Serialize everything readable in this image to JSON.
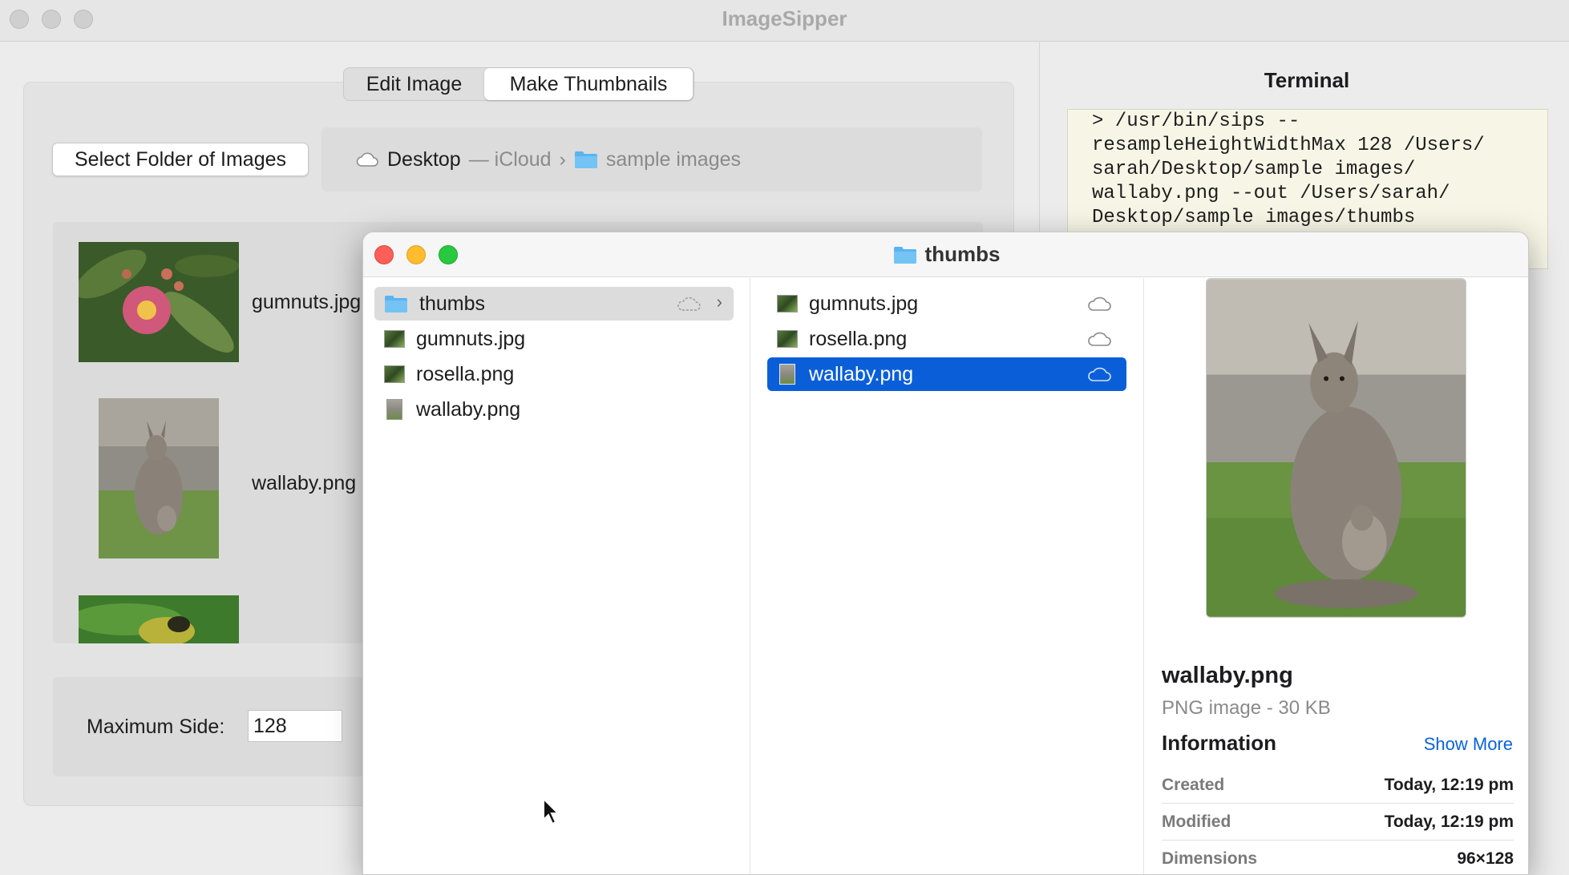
{
  "app": {
    "title": "ImageSipper"
  },
  "tabs": {
    "edit_label": "Edit Image",
    "make_label": "Make Thumbnails"
  },
  "toolbar": {
    "select_folder_label": "Select Folder of Images"
  },
  "path": {
    "desktop": "Desktop",
    "icloud": "— iCloud",
    "separator": "›",
    "folder": "sample images"
  },
  "thumbnails": [
    {
      "name": "gumnuts.jpg"
    },
    {
      "name": "wallaby.png"
    }
  ],
  "settings": {
    "max_side_label": "Maximum Side:",
    "max_side_value": "128"
  },
  "terminal": {
    "title": "Terminal",
    "text": "> /usr/bin/sips --\nresampleHeightWidthMax 128 /Users/\nsarah/Desktop/sample images/\nwallaby.png --out /Users/sarah/\nDesktop/sample images/thumbs"
  },
  "finder": {
    "title": "thumbs",
    "col1": [
      {
        "name": "thumbs",
        "type": "folder",
        "selected": true
      },
      {
        "name": "gumnuts.jpg",
        "type": "image"
      },
      {
        "name": "rosella.png",
        "type": "image"
      },
      {
        "name": "wallaby.png",
        "type": "image-portrait"
      }
    ],
    "col2": [
      {
        "name": "gumnuts.jpg",
        "type": "image"
      },
      {
        "name": "rosella.png",
        "type": "image"
      },
      {
        "name": "wallaby.png",
        "type": "image-portrait",
        "selected": true
      }
    ],
    "preview": {
      "name": "wallaby.png",
      "kind": "PNG image - 30 KB",
      "info_heading": "Information",
      "show_more": "Show More",
      "rows": [
        {
          "key": "Created",
          "value": "Today, 12:19 pm"
        },
        {
          "key": "Modified",
          "value": "Today, 12:19 pm"
        },
        {
          "key": "Dimensions",
          "value": "96×128"
        }
      ]
    }
  },
  "colors": {
    "accent": "#0a5fd9",
    "terminal_bg": "#f7f6e6",
    "link": "#0a63d8"
  }
}
